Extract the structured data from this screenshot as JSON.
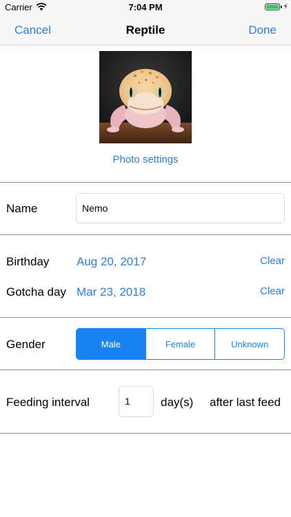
{
  "status_bar": {
    "carrier": "Carrier",
    "time": "7:04 PM",
    "battery_level": 1.0
  },
  "nav": {
    "cancel_label": "Cancel",
    "title": "Reptile",
    "done_label": "Done"
  },
  "photo": {
    "settings_label": "Photo settings"
  },
  "form": {
    "name_label": "Name",
    "name_value": "Nemo",
    "birthday_label": "Birthday",
    "birthday_value": "Aug 20, 2017",
    "gotcha_label": "Gotcha day",
    "gotcha_value": "Mar 23, 2018",
    "clear_label": "Clear",
    "gender_label": "Gender",
    "gender_options": [
      "Male",
      "Female",
      "Unknown"
    ],
    "gender_selected": "Male",
    "feeding_label": "Feeding interval",
    "feeding_value": "1",
    "feeding_unit": "day(s)",
    "feeding_suffix": "after last feed"
  },
  "colors": {
    "accent": "#2b7fd9",
    "segment": "#1b82f1",
    "battery": "#34c759"
  }
}
